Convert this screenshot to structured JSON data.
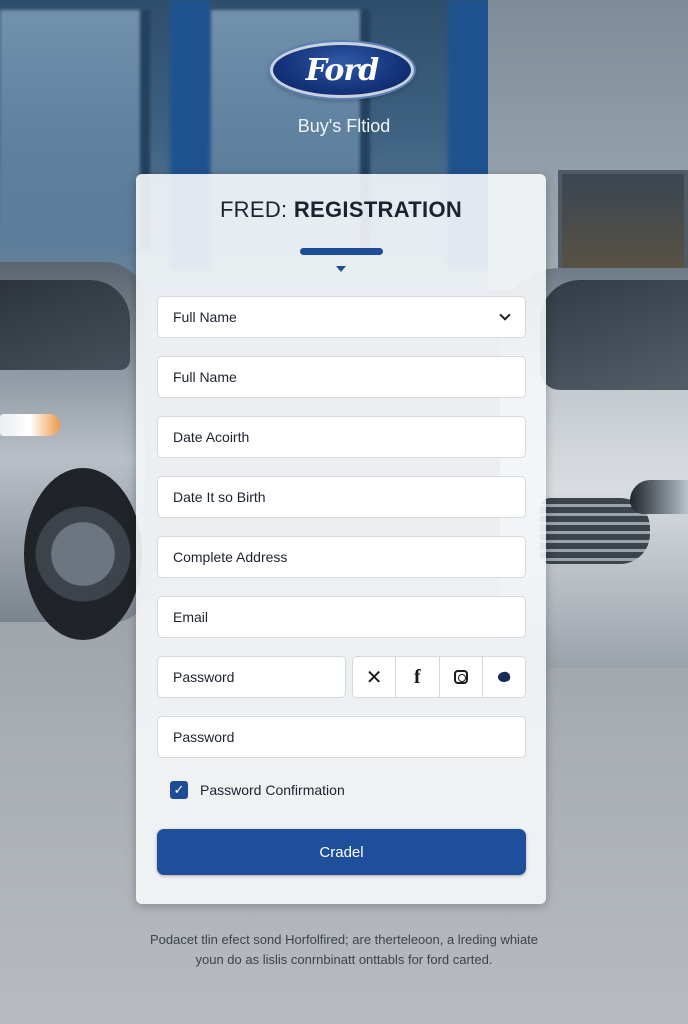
{
  "brand": {
    "logo_text": "Ford",
    "tagline": "Buy's Fltiod"
  },
  "form": {
    "title_light": "FRED: ",
    "title_bold": "REGISTRATION",
    "fields": [
      "Full Name",
      "Full Name",
      "Date Acoirth",
      "Date It so Birth",
      "Complete Address",
      "Email",
      "Password",
      "Password"
    ],
    "social_icons": [
      "x-icon",
      "facebook-icon",
      "instagram-icon",
      "twitter-icon"
    ],
    "social_x_glyph": "✕",
    "social_f_glyph": "f",
    "checkbox_label": "Password Confirmation",
    "checkbox_checked": true,
    "submit_label": "Cradel"
  },
  "footer": {
    "line1": "Podacet tlin efect sond Horfolfired; are therteleoon, a lreding whiate",
    "line2": "youn do as lislis conrnbinatt onttabls for ford carted."
  },
  "colors": {
    "accent": "#1f4f9a",
    "card_bg": "#f6f8fa"
  }
}
